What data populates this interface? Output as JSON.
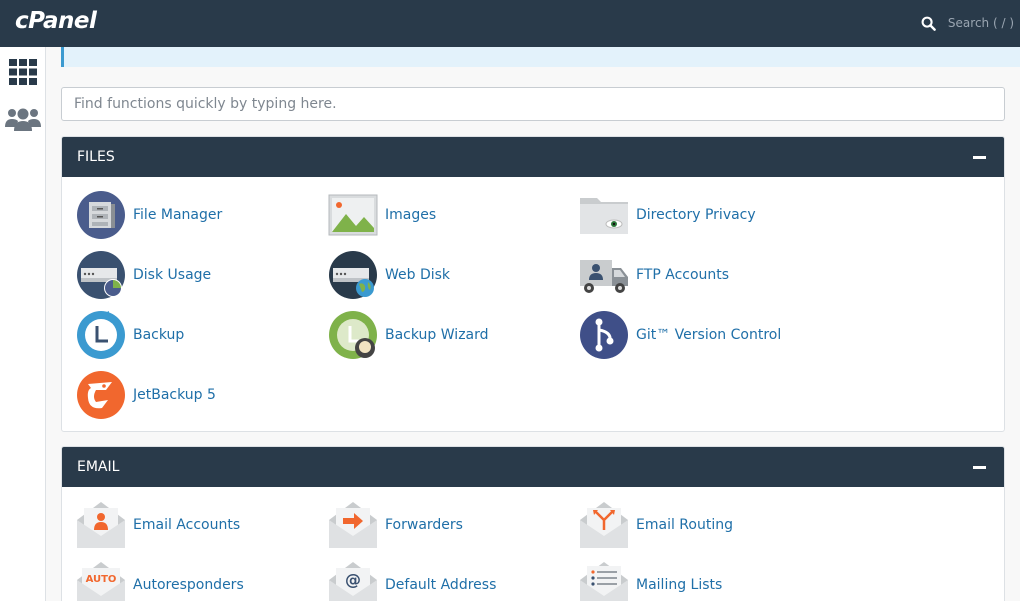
{
  "topbar": {
    "logo": "cPanel",
    "search_placeholder": "Search ( / )"
  },
  "quick_search": {
    "placeholder": "Find functions quickly by typing here."
  },
  "sections": {
    "files": {
      "title": "FILES",
      "items": [
        {
          "label": "File Manager",
          "icon": "file-manager-icon"
        },
        {
          "label": "Images",
          "icon": "images-icon"
        },
        {
          "label": "Directory Privacy",
          "icon": "directory-privacy-icon"
        },
        {
          "label": "Disk Usage",
          "icon": "disk-usage-icon"
        },
        {
          "label": "Web Disk",
          "icon": "web-disk-icon"
        },
        {
          "label": "FTP Accounts",
          "icon": "ftp-accounts-icon"
        },
        {
          "label": "Backup",
          "icon": "backup-icon"
        },
        {
          "label": "Backup Wizard",
          "icon": "backup-wizard-icon"
        },
        {
          "label": "Git™ Version Control",
          "icon": "git-icon"
        },
        {
          "label": "JetBackup 5",
          "icon": "jetbackup-icon"
        }
      ]
    },
    "email": {
      "title": "EMAIL",
      "items": [
        {
          "label": "Email Accounts",
          "icon": "email-accounts-icon"
        },
        {
          "label": "Forwarders",
          "icon": "forwarders-icon"
        },
        {
          "label": "Email Routing",
          "icon": "email-routing-icon"
        },
        {
          "label": "Autoresponders",
          "icon": "autoresponders-icon",
          "icon_text": "AUTO"
        },
        {
          "label": "Default Address",
          "icon": "default-address-icon",
          "icon_text": "@"
        },
        {
          "label": "Mailing Lists",
          "icon": "mailing-lists-icon"
        }
      ]
    }
  },
  "colors": {
    "header": "#293a4a",
    "link": "#1f6fa8",
    "accent_orange": "#f1672e",
    "accent_blue": "#3b9ad0"
  }
}
